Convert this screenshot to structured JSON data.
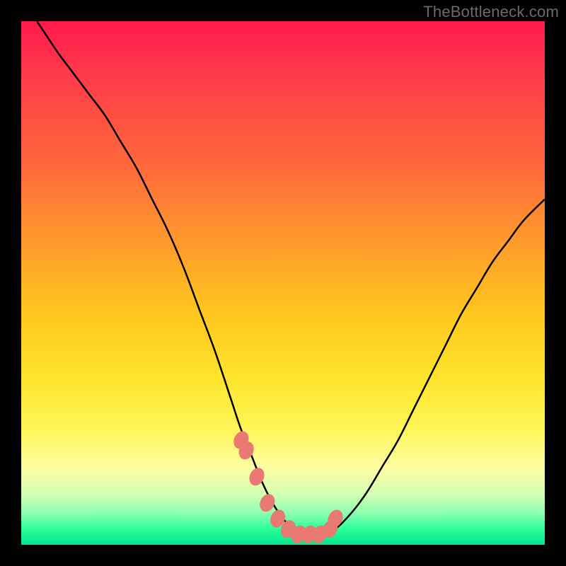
{
  "watermark": "TheBottleneck.com",
  "colors": {
    "background": "#000000",
    "curve_stroke": "#000000",
    "marker_fill": "#e97a72",
    "gradient_top": "#ff1a4d",
    "gradient_bottom": "#00e68a"
  },
  "chart_data": {
    "type": "line",
    "title": "",
    "xlabel": "",
    "ylabel": "",
    "xlim": [
      0,
      100
    ],
    "ylim": [
      0,
      100
    ],
    "x": [
      3,
      5,
      7,
      10,
      13,
      16,
      19,
      22,
      25,
      28,
      31,
      34,
      37,
      40,
      42,
      44,
      46,
      48,
      50,
      52,
      54,
      56,
      58,
      60,
      63,
      66,
      69,
      72,
      75,
      78,
      81,
      84,
      87,
      90,
      93,
      96,
      100
    ],
    "values": [
      100,
      97,
      94,
      90,
      86,
      82,
      77,
      72,
      66,
      60,
      53,
      45,
      37,
      28,
      22,
      17,
      12,
      8,
      5,
      3,
      2,
      2,
      2,
      3,
      6,
      10,
      15,
      20,
      26,
      32,
      38,
      44,
      49,
      54,
      58,
      62,
      66
    ],
    "markers": {
      "x": [
        42,
        43,
        45,
        47,
        49,
        51,
        53,
        55,
        57,
        59,
        60
      ],
      "y": [
        20,
        18,
        13,
        8,
        5,
        3,
        2,
        2,
        2,
        3,
        5
      ]
    },
    "notes": "Values estimated from pixel positions; 0 = bottom, 100 = top. Gradient background from red (top) through yellow to green (bottom). Curve resembles a bottleneck/valley shape with salmon-colored oval markers near the trough."
  }
}
